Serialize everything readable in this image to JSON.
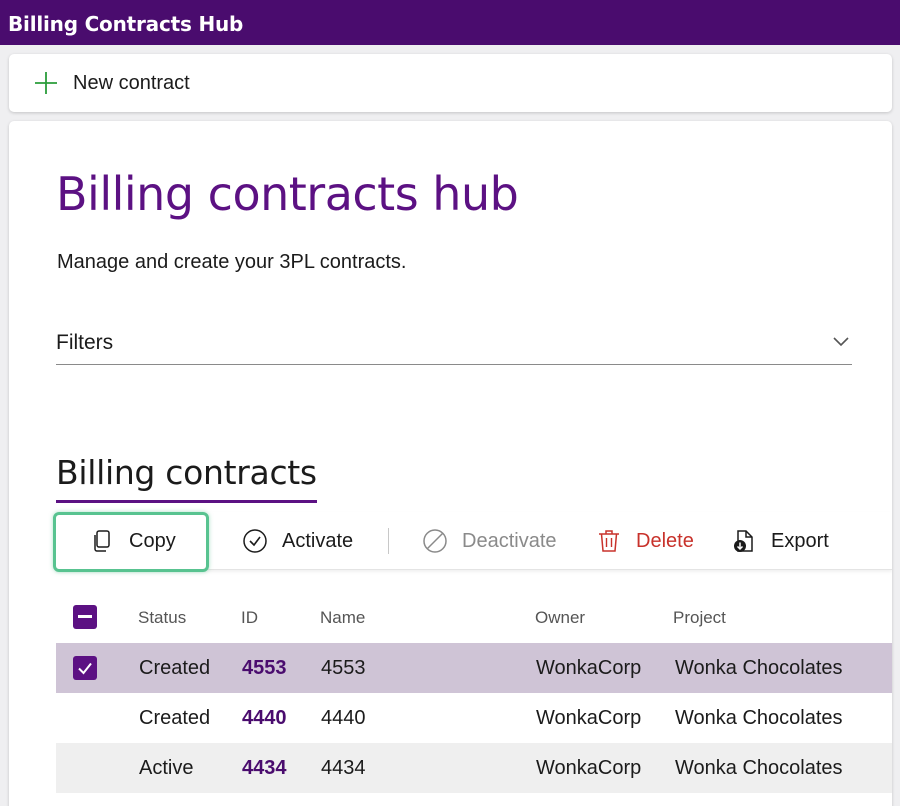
{
  "app": {
    "title": "Billing Contracts Hub"
  },
  "command_bar": {
    "new_contract_label": "New contract"
  },
  "page": {
    "title": "Billing contracts hub",
    "subtitle": "Manage and create your 3PL contracts.",
    "filters_label": "Filters",
    "section_title": "Billing contracts"
  },
  "actions": {
    "copy": "Copy",
    "activate": "Activate",
    "deactivate": "Deactivate",
    "delete": "Delete",
    "export": "Export"
  },
  "table": {
    "columns": [
      "Status",
      "ID",
      "Name",
      "Owner",
      "Project"
    ],
    "rows": [
      {
        "status": "Created",
        "id": "4553",
        "name": "4553",
        "owner": "WonkaCorp",
        "project": "Wonka Chocolates",
        "selected": true
      },
      {
        "status": "Created",
        "id": "4440",
        "name": "4440",
        "owner": "WonkaCorp",
        "project": "Wonka Chocolates",
        "selected": false
      },
      {
        "status": "Active",
        "id": "4434",
        "name": "4434",
        "owner": "WonkaCorp",
        "project": "Wonka Chocolates",
        "selected": false
      }
    ]
  },
  "colors": {
    "brand": "#4a0c6e",
    "accent": "#5c1183",
    "selected_row": "#cfc4d6",
    "alt_row": "#efefef",
    "delete": "#c8322b",
    "disabled": "#8a8a8a",
    "success_outline": "#58c390",
    "add_icon": "#2a9d3a"
  }
}
